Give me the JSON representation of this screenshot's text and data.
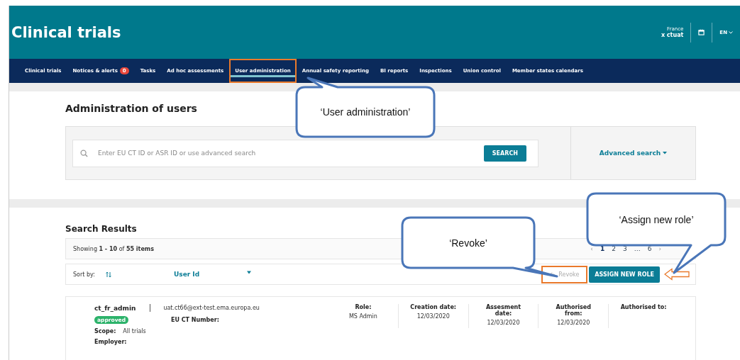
{
  "header": {
    "title": "Clinical trials",
    "country": "France",
    "user": "x ctuat",
    "language": "EN"
  },
  "nav": [
    {
      "label": "Clinical trials",
      "selected": false,
      "highlighted": false
    },
    {
      "label": "Notices & alerts",
      "badge": "0",
      "selected": false,
      "highlighted": false
    },
    {
      "label": "Tasks",
      "selected": false,
      "highlighted": false
    },
    {
      "label": "Ad hoc assessments",
      "selected": false,
      "highlighted": false
    },
    {
      "label": "User administration",
      "selected": true,
      "highlighted": true
    },
    {
      "label": "Annual safety reporting",
      "selected": false,
      "highlighted": false
    },
    {
      "label": "BI reports",
      "selected": false,
      "highlighted": false
    },
    {
      "label": "Inspections",
      "selected": false,
      "highlighted": false
    },
    {
      "label": "Union control",
      "selected": false,
      "highlighted": false
    },
    {
      "label": "Member states calendars",
      "selected": false,
      "highlighted": false
    }
  ],
  "admin": {
    "title": "Administration of users",
    "search_placeholder": "Enter EU CT ID or ASR ID or use advanced search",
    "search_button": "SEARCH",
    "advanced_search": "Advanced search"
  },
  "results": {
    "title": "Search Results",
    "showing": "Showing **1 - 10** of **55 items**",
    "pagination": [
      {
        "label": "‹",
        "kind": "arrow",
        "selected": false
      },
      {
        "label": "1",
        "kind": "page",
        "selected": true
      },
      {
        "label": "2",
        "kind": "page",
        "selected": false
      },
      {
        "label": "3",
        "kind": "page",
        "selected": false
      },
      {
        "label": "…",
        "kind": "gap",
        "selected": false
      },
      {
        "label": "6",
        "kind": "page",
        "selected": false
      },
      {
        "label": "›",
        "kind": "arrow",
        "selected": false
      }
    ],
    "sort_label": "Sort by:",
    "sort_value": "User Id",
    "revoke": {
      "label": "Revoke",
      "disabled": true,
      "highlighted": true
    },
    "assign": {
      "label": "ASSIGN NEW ROLE",
      "highlighted": true
    }
  },
  "record": {
    "username": "ct_fr_admin",
    "email": "uat.ct66@ext-test.ema.europa.eu",
    "status": "approved",
    "eu_ct_label": "EU CT Number:",
    "scope_label": "Scope:",
    "scope_value": "All trials",
    "employer_label": "Employer:",
    "columns": [
      {
        "heading": "Role:",
        "value": "MS Admin"
      },
      {
        "heading": "Creation date:",
        "value": "12/03/2020"
      },
      {
        "heading": "Assesment date:",
        "value": "12/03/2020"
      },
      {
        "heading": "Authorised from:",
        "value": "12/03/2020"
      },
      {
        "heading": "Authorised to:"
      }
    ]
  },
  "callouts": [
    {
      "text": "‘User administration’"
    },
    {
      "text": "‘Revoke’"
    },
    {
      "text": "‘Assign new role’"
    }
  ]
}
